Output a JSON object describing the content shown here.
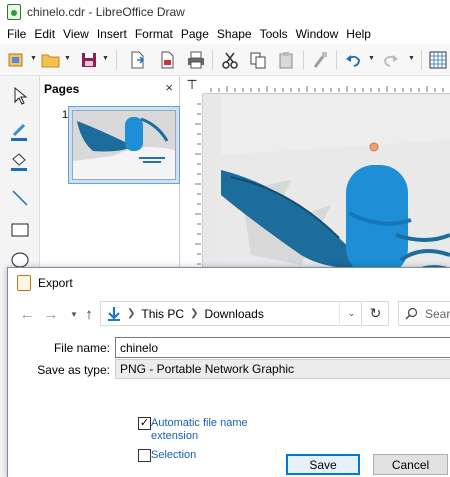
{
  "window": {
    "title": "chinelo.cdr - LibreOffice Draw"
  },
  "menu": {
    "items": [
      "File",
      "Edit",
      "View",
      "Insert",
      "Format",
      "Page",
      "Shape",
      "Tools",
      "Window",
      "Help"
    ]
  },
  "toolbar": {
    "icons": [
      "templates-icon",
      "open-icon",
      "save-icon",
      "export-icon",
      "export-pdf-icon",
      "print-icon",
      "cut-icon",
      "copy-icon",
      "paste-icon",
      "clone-formatting-icon",
      "undo-icon",
      "redo-icon",
      "grid-icon"
    ]
  },
  "pages_pane": {
    "title": "Pages",
    "close_glyph": "×",
    "page_number": "1"
  },
  "canvas": {
    "ruler_corner_glyph": "⊤"
  },
  "dialog": {
    "title": "Export",
    "path": [
      "This PC",
      "Downloads"
    ],
    "search_placeholder": "Sear",
    "file_name_label": "File name:",
    "file_name_value": "chinelo",
    "save_as_type_label": "Save as type:",
    "save_as_type_value": "PNG - Portable Network Graphic",
    "auto_extension_label": "Automatic file name extension",
    "auto_extension_checked": true,
    "selection_label": "Selection",
    "selection_checked": false,
    "save_label": "Save",
    "cancel_label": "Cancel"
  },
  "colors": {
    "accent": "#0078d7",
    "shoe_blue": "#1e8fd6",
    "shoe_dark": "#1c6c9c"
  }
}
